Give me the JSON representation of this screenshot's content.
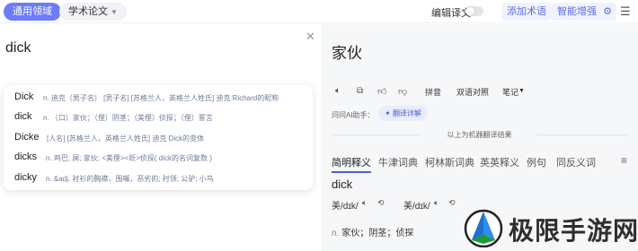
{
  "header": {
    "domain_tab": "通用领域",
    "paper_tab": "学术论文",
    "edit_label": "编辑译文",
    "add_term": "添加术语",
    "smart_enhance": "智能增强"
  },
  "source": {
    "text": "dick"
  },
  "suggestions": [
    {
      "word": "Dick",
      "definition": "n. 迪克（男子名） [男子名] [苏格兰人，英格兰人姓氏] 迪克 Richard的昵称"
    },
    {
      "word": "dick",
      "definition": "n. （口）家伙；（俚）阴茎；（美俚）侦探；（俚）誓言"
    },
    {
      "word": "Dicke",
      "definition": "[人名] [苏格兰人，英格兰人姓氏] 迪克 Dick的变体"
    },
    {
      "word": "dicks",
      "definition": "n. 鸡巴; 屌; 家伙; <美俚><贬>侦探( dick的名词复数 )"
    },
    {
      "word": "dicky",
      "definition": "n. &adj. 衬衫的胸襟，围嘴，恶劣的; 衬领; 公驴; 小鸟"
    }
  ],
  "result": {
    "text": "家伙"
  },
  "toolbar": {
    "pinyin": "拼音",
    "bilingual": "双语对照",
    "notes": "笔记"
  },
  "ai": {
    "label": "问问AI助手：",
    "button": "翻译详解"
  },
  "mt_note": "以上为机器翻译结果",
  "dict_tabs": [
    "简明释义",
    "牛津词典",
    "柯林斯词典",
    "英英释义",
    "例句",
    "同反义词"
  ],
  "entry": {
    "word": "dick",
    "us_label": "美/dɪk/",
    "uk_label": "美/dɪk/",
    "pos": "n.",
    "definition": "家伙；阴茎；侦探"
  },
  "watermark": {
    "text": "极限手游网"
  },
  "colors": {
    "accent": "#6d7cf7",
    "link": "#4a5fd6",
    "right_bg": "#f6f7f9"
  }
}
